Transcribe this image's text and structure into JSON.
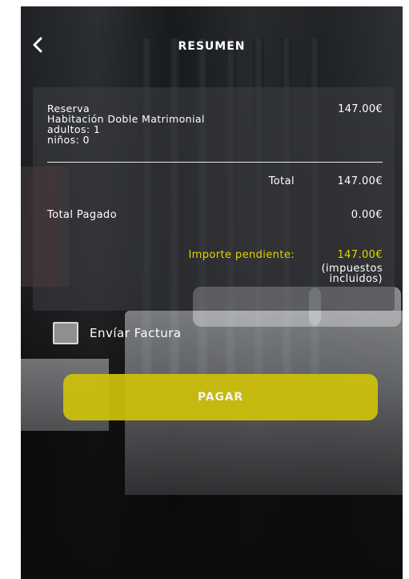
{
  "header": {
    "title": "RESUMEN",
    "back_icon": "chevron-left-icon"
  },
  "summary": {
    "reservation_label": "Reserva",
    "room_type": "Habitación Doble Matrimonial",
    "adults": "adultos: 1",
    "children": "niños: 0",
    "reservation_price": "147.00€",
    "total_label": "Total",
    "total_value": "147.00€",
    "paid_label": "Total Pagado",
    "paid_value": "0.00€",
    "pending_label": "Importe pendiente:",
    "pending_value": "147.00€",
    "taxes_line1": "(impuestos",
    "taxes_line2": "incluidos)"
  },
  "invoice": {
    "label": "Envíar Factura",
    "checked": false
  },
  "actions": {
    "pay_label": "PAGAR"
  },
  "colors": {
    "accent": "#cfc20a",
    "pending_text": "#e5d400"
  }
}
